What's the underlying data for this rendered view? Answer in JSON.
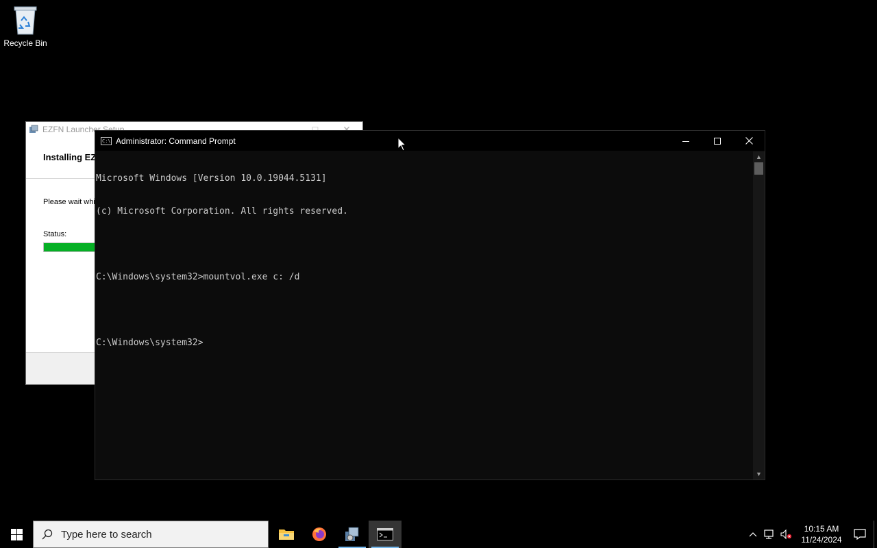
{
  "desktop": {
    "icons": [
      {
        "label": "Recycle Bin"
      }
    ]
  },
  "installer": {
    "title": "EZFN Launcher Setup",
    "header": "Installing EZ",
    "wait_text": "Please wait whil",
    "status_label": "Status:",
    "progress_percent": 17
  },
  "cmd": {
    "title": "Administrator: Command Prompt",
    "icon_text": "C:\\",
    "lines": [
      "Microsoft Windows [Version 10.0.19044.5131]",
      "(c) Microsoft Corporation. All rights reserved.",
      "",
      "C:\\Windows\\system32>mountvol.exe c: /d",
      "",
      "C:\\Windows\\system32>"
    ]
  },
  "taskbar": {
    "search_placeholder": "Type here to search",
    "apps": [
      {
        "name": "file-explorer",
        "active": false
      },
      {
        "name": "firefox",
        "active": false
      },
      {
        "name": "setup-installer",
        "active": false
      },
      {
        "name": "command-prompt",
        "active": true
      }
    ],
    "accent_color": "#76b9ed",
    "clock": {
      "time": "10:15 AM",
      "date": "11/24/2024"
    }
  }
}
